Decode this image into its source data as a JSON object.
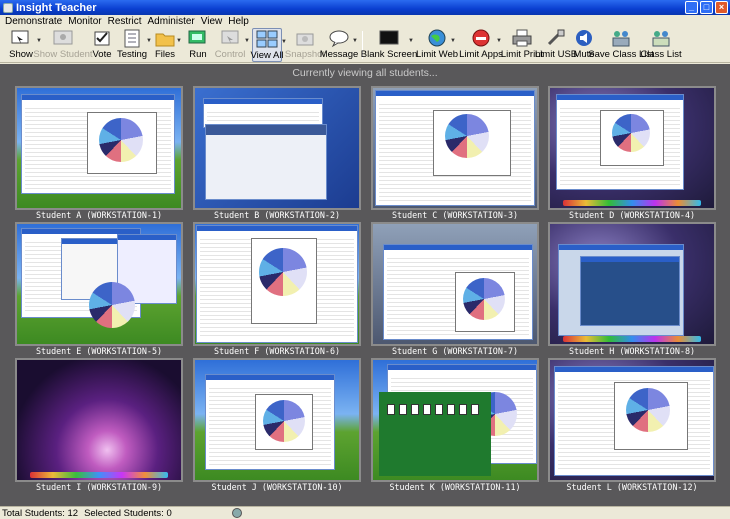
{
  "window": {
    "title": "Insight Teacher"
  },
  "menu": [
    "Demonstrate",
    "Monitor",
    "Restrict",
    "Administer",
    "View",
    "Help"
  ],
  "toolbar": {
    "show": "Show",
    "show_student": "Show Student",
    "vote": "Vote",
    "testing": "Testing",
    "files": "Files",
    "run": "Run",
    "control": "Control",
    "view_all": "View All",
    "snapshot": "Snapshot",
    "message": "Message",
    "blank_screen": "Blank Screen",
    "limit_web": "Limit Web",
    "limit_apps": "Limit Apps",
    "limit_print": "Limit Print",
    "limit_usb": "Limit USB",
    "mute": "Mute",
    "save_class_list": "Save Class List",
    "class_list": "Class List"
  },
  "caption": "Currently viewing all students...",
  "students": [
    {
      "label": "Student A (WORKSTATION-1)"
    },
    {
      "label": "Student B (WORKSTATION-2)"
    },
    {
      "label": "Student C (WORKSTATION-3)"
    },
    {
      "label": "Student D (WORKSTATION-4)"
    },
    {
      "label": "Student E (WORKSTATION-5)"
    },
    {
      "label": "Student F (WORKSTATION-6)"
    },
    {
      "label": "Student G (WORKSTATION-7)"
    },
    {
      "label": "Student H (WORKSTATION-8)"
    },
    {
      "label": "Student I (WORKSTATION-9)"
    },
    {
      "label": "Student J (WORKSTATION-10)"
    },
    {
      "label": "Student K (WORKSTATION-11)"
    },
    {
      "label": "Student L (WORKSTATION-12)"
    }
  ],
  "status": {
    "total": "Total Students: 12",
    "selected": "Selected Students: 0"
  }
}
